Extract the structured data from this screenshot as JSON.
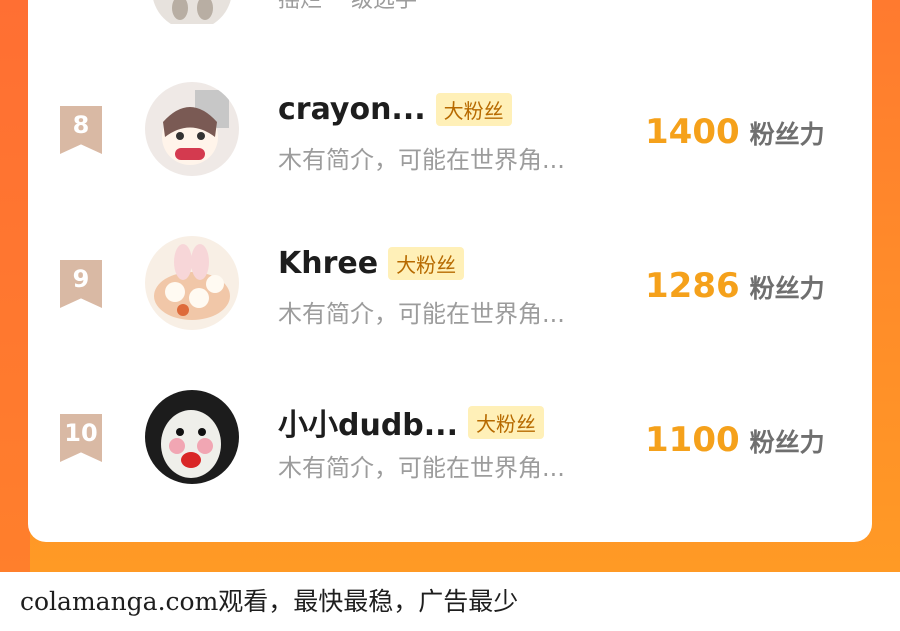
{
  "prev_row": {
    "text": "摇烂 一级选手"
  },
  "rows": [
    {
      "rank": "8",
      "name": "crayon...",
      "badge": "大粉丝",
      "desc": "木有简介，可能在世界角...",
      "score": "1400",
      "unit": "粉丝力",
      "avatar_icon": "anime-girl-avatar"
    },
    {
      "rank": "9",
      "name": "Khree",
      "badge": "大粉丝",
      "desc": "木有简介，可能在世界角...",
      "score": "1286",
      "unit": "粉丝力",
      "avatar_icon": "bunny-food-avatar"
    },
    {
      "rank": "10",
      "name": "小小dudb...",
      "badge": "大粉丝",
      "desc": "木有简介，可能在世界角...",
      "score": "1100",
      "unit": "粉丝力",
      "avatar_icon": "meme-face-avatar"
    }
  ],
  "footer": {
    "text": "colamanga.com观看，最快最稳，广告最少"
  },
  "colors": {
    "background": "#ff8a2a",
    "score": "#f5a11b",
    "badge_bg": "#fff0b8",
    "rank": "#d9b9a4"
  }
}
